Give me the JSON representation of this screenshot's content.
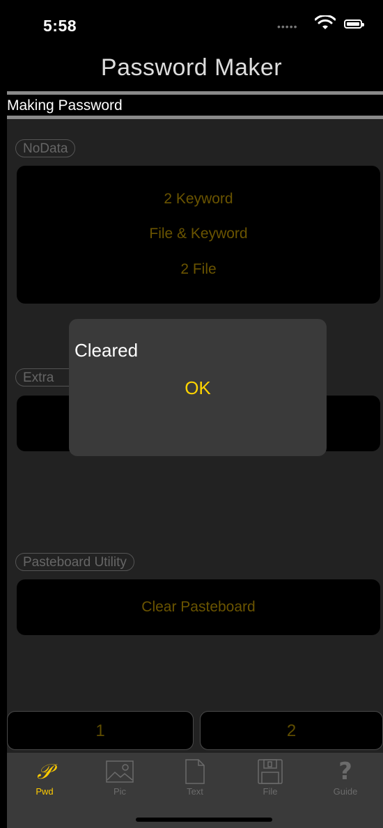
{
  "status_bar": {
    "time": "5:58"
  },
  "nav": {
    "title": "Password Maker"
  },
  "section": {
    "label": "Making Password"
  },
  "groups": [
    {
      "badge": "NoData",
      "buttons": [
        "2 Keyword",
        "File & Keyword",
        "2 File"
      ]
    },
    {
      "badge": "Extra"
    },
    {
      "badge": "Pasteboard Utility",
      "buttons": [
        "Clear Pasteboard"
      ]
    }
  ],
  "segments": [
    "1",
    "2"
  ],
  "tabs": [
    {
      "label": "Pwd",
      "icon": "script-p-icon",
      "active": true
    },
    {
      "label": "Pic",
      "icon": "picture-icon"
    },
    {
      "label": "Text",
      "icon": "document-icon"
    },
    {
      "label": "File",
      "icon": "floppy-disk-icon"
    },
    {
      "label": "Guide",
      "icon": "question-icon"
    }
  ],
  "dialog": {
    "message": "Cleared",
    "ok_label": "OK"
  },
  "colors": {
    "accent": "#ffcc00",
    "dim_gold": "#6a5400",
    "panel": "#000000",
    "background": "#222222"
  }
}
